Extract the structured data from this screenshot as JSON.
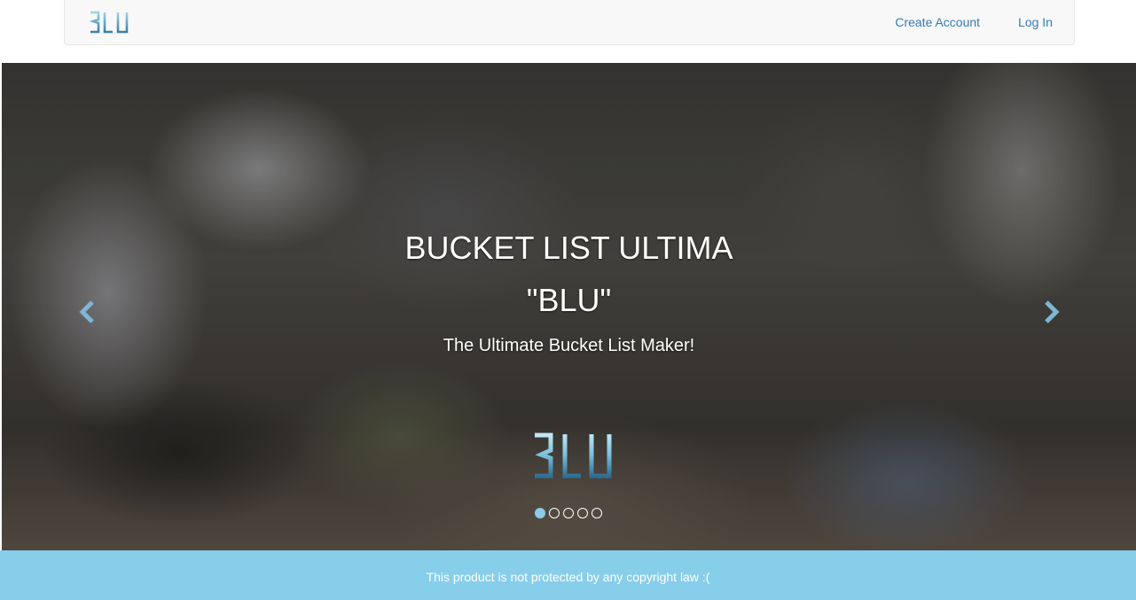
{
  "navbar": {
    "brand_logo_text": "BLU",
    "links": [
      {
        "label": "Create Account"
      },
      {
        "label": "Log In"
      }
    ]
  },
  "carousel": {
    "title_line1": "BUCKET LIST ULTIMA",
    "title_line2": "\"BLU\"",
    "subtitle": "The Ultimate Bucket List Maker!",
    "logo_text": "BLU",
    "prev_icon": "chevron-left-icon",
    "next_icon": "chevron-right-icon",
    "slide_count": 5,
    "active_slide": 1
  },
  "footer": {
    "text": "This product is not protected by any copyright law :("
  },
  "colors": {
    "accent": "#87ceeb",
    "link": "#337ab7",
    "navbar_bg": "#f8f8f8",
    "logo": "#6fb6d6"
  }
}
